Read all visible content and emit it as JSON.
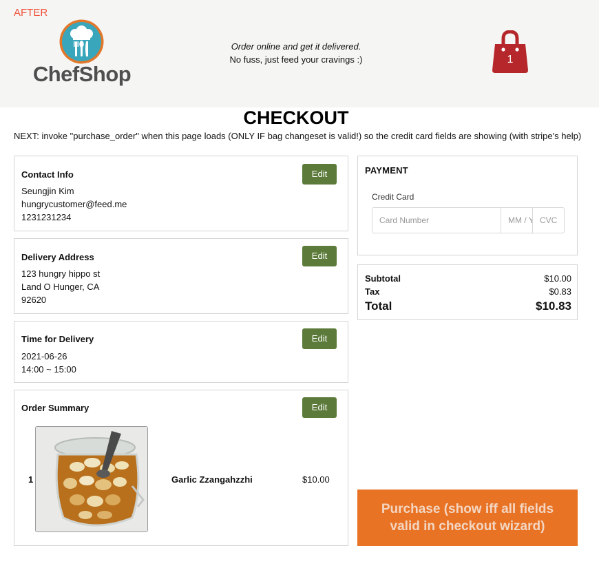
{
  "header": {
    "badge": "AFTER",
    "brand": "ChefShop",
    "tagline_line1": "Order online and get it delivered.",
    "tagline_line2": "No fuss, just feed your cravings :)",
    "bag_count": "1"
  },
  "page": {
    "title": "CHECKOUT",
    "note": "NEXT: invoke \"purchase_order\" when this page loads (ONLY IF bag changeset is valid!) so the credit card fields are showing (with stripe's help)"
  },
  "contact": {
    "title": "Contact Info",
    "edit_label": "Edit",
    "name": "Seungjin Kim",
    "email": "hungrycustomer@feed.me",
    "phone": "1231231234"
  },
  "delivery": {
    "title": "Delivery Address",
    "edit_label": "Edit",
    "street": "123 hungry hippo st",
    "city": "Land O Hunger, CA",
    "zip": "92620"
  },
  "time": {
    "title": "Time for Delivery",
    "edit_label": "Edit",
    "date": "2021-06-26",
    "window": "14:00 ~ 15:00"
  },
  "order": {
    "title": "Order Summary",
    "edit_label": "Edit",
    "items": [
      {
        "qty": "1",
        "name": "Garlic Zzangahzzhi",
        "price": "$10.00"
      }
    ]
  },
  "payment": {
    "title": "PAYMENT",
    "cc_label": "Credit Card",
    "card_number_placeholder": "Card Number",
    "expiry_placeholder": "MM / YY",
    "cvc_placeholder": "CVC"
  },
  "totals": {
    "subtotal_label": "Subtotal",
    "subtotal": "$10.00",
    "tax_label": "Tax",
    "tax": "$0.83",
    "total_label": "Total",
    "total": "$10.83"
  },
  "purchase": {
    "label": "Purchase (show iff all fields valid in checkout wizard)"
  },
  "colors": {
    "badge": "#f0503a",
    "edit_button": "#5c7a3a",
    "purchase_button": "#e97325",
    "bag": "#b5272a",
    "logo_ring": "#e2772a",
    "logo_fill": "#3aa6bb"
  },
  "icons": {
    "logo": "chef-hat-utensils-icon",
    "bag": "shopping-bag-icon"
  }
}
